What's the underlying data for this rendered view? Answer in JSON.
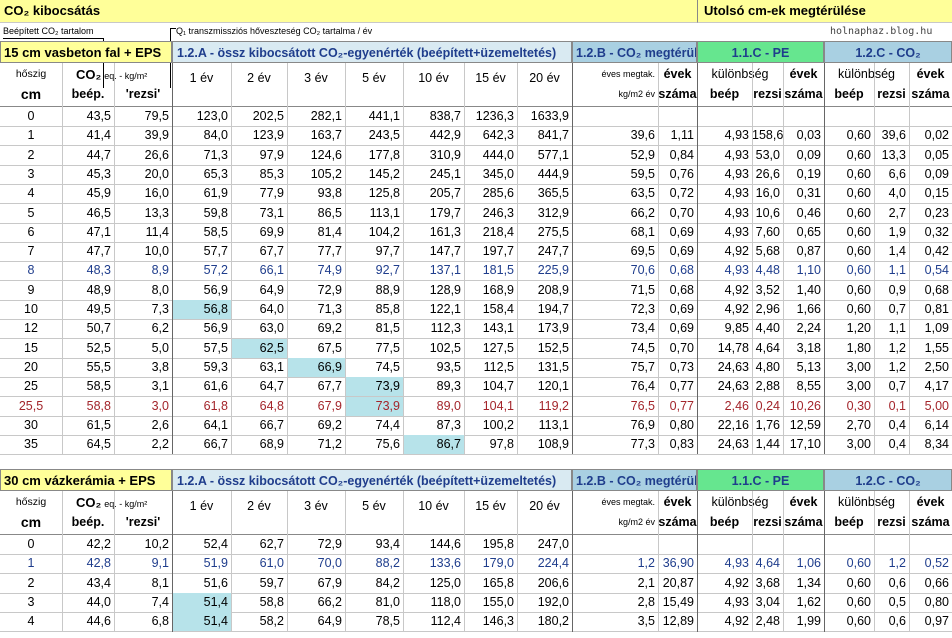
{
  "header": {
    "title": "CO₂ kibocsátás",
    "right_title": "Utolsó cm-ek megtérülése",
    "site": "holnaphaz.blog.hu",
    "ann1": "Beépített CO₂ tartalom",
    "ann2": "Q₁ transzmissziós hőveszteség CO₂ tartalma / év"
  },
  "colors": {
    "yellow": "#ffff99",
    "green": "#66e68f",
    "lightgreen": "#d6f5df",
    "blue": "#a9d0e2",
    "lightblue": "#d9eaf2",
    "highlight": "#b7e3ea",
    "rowblue": "#1f3d8c",
    "rowred": "#a3252b"
  },
  "headers": {
    "col_hoszig": "hőszig",
    "col_cm": "cm",
    "col_co2": "CO₂",
    "col_co2_unit": "eq. - kg/m²",
    "col_beep": "beép.",
    "col_rezsi": "'rezsi'",
    "years": [
      "1 év",
      "2 év",
      "3 év",
      "5 év",
      "10 év",
      "15 év",
      "20 év"
    ],
    "eves_megtak": "éves megtak.",
    "kg_m2_ev": "kg/m2 év",
    "evek": "évek",
    "szama": "száma",
    "kulonbseg": "különbség",
    "beep": "beép",
    "rezsi": "rezsi"
  },
  "section1": {
    "label": "15 cm vasbeton fal + EPS",
    "title_12a": "1.2.A - össz kibocsátott CO₂-egyenérték (beépített+üzemeltetés)",
    "title_12b": "1.2.B - CO₂ megtérül",
    "title_11c": "1.1.C - PE",
    "title_12c": "1.2.C - CO₂",
    "rows": [
      [
        "0",
        "43,5",
        "79,5",
        "123,0",
        "202,5",
        "282,1",
        "441,1",
        "838,7",
        "1236,3",
        "1633,9",
        "",
        "",
        "",
        "",
        "",
        "",
        "",
        ""
      ],
      [
        "1",
        "41,4",
        "39,9",
        "84,0",
        "123,9",
        "163,7",
        "243,5",
        "442,9",
        "642,3",
        "841,7",
        "39,6",
        "1,11",
        "4,93",
        "158,6",
        "0,03",
        "0,60",
        "39,6",
        "0,02"
      ],
      [
        "2",
        "44,7",
        "26,6",
        "71,3",
        "97,9",
        "124,6",
        "177,8",
        "310,9",
        "444,0",
        "577,1",
        "52,9",
        "0,84",
        "4,93",
        "53,0",
        "0,09",
        "0,60",
        "13,3",
        "0,05"
      ],
      [
        "3",
        "45,3",
        "20,0",
        "65,3",
        "85,3",
        "105,2",
        "145,2",
        "245,1",
        "345,0",
        "444,9",
        "59,5",
        "0,76",
        "4,93",
        "26,6",
        "0,19",
        "0,60",
        "6,6",
        "0,09"
      ],
      [
        "4",
        "45,9",
        "16,0",
        "61,9",
        "77,9",
        "93,8",
        "125,8",
        "205,7",
        "285,6",
        "365,5",
        "63,5",
        "0,72",
        "4,93",
        "16,0",
        "0,31",
        "0,60",
        "4,0",
        "0,15"
      ],
      [
        "5",
        "46,5",
        "13,3",
        "59,8",
        "73,1",
        "86,5",
        "113,1",
        "179,7",
        "246,3",
        "312,9",
        "66,2",
        "0,70",
        "4,93",
        "10,6",
        "0,46",
        "0,60",
        "2,7",
        "0,23"
      ],
      [
        "6",
        "47,1",
        "11,4",
        "58,5",
        "69,9",
        "81,4",
        "104,2",
        "161,3",
        "218,4",
        "275,5",
        "68,1",
        "0,69",
        "4,93",
        "7,60",
        "0,65",
        "0,60",
        "1,9",
        "0,32"
      ],
      [
        "7",
        "47,7",
        "10,0",
        "57,7",
        "67,7",
        "77,7",
        "97,7",
        "147,7",
        "197,7",
        "247,7",
        "69,5",
        "0,69",
        "4,92",
        "5,68",
        "0,87",
        "0,60",
        "1,4",
        "0,42"
      ],
      [
        "8",
        "48,3",
        "8,9",
        "57,2",
        "66,1",
        "74,9",
        "92,7",
        "137,1",
        "181,5",
        "225,9",
        "70,6",
        "0,68",
        "4,93",
        "4,48",
        "1,10",
        "0,60",
        "1,1",
        "0,54"
      ],
      [
        "9",
        "48,9",
        "8,0",
        "56,9",
        "64,9",
        "72,9",
        "88,9",
        "128,9",
        "168,9",
        "208,9",
        "71,5",
        "0,68",
        "4,92",
        "3,52",
        "1,40",
        "0,60",
        "0,9",
        "0,68"
      ],
      [
        "10",
        "49,5",
        "7,3",
        "56,8",
        "64,0",
        "71,3",
        "85,8",
        "122,1",
        "158,4",
        "194,7",
        "72,3",
        "0,69",
        "4,92",
        "2,96",
        "1,66",
        "0,60",
        "0,7",
        "0,81"
      ],
      [
        "12",
        "50,7",
        "6,2",
        "56,9",
        "63,0",
        "69,2",
        "81,5",
        "112,3",
        "143,1",
        "173,9",
        "73,4",
        "0,69",
        "9,85",
        "4,40",
        "2,24",
        "1,20",
        "1,1",
        "1,09"
      ],
      [
        "15",
        "52,5",
        "5,0",
        "57,5",
        "62,5",
        "67,5",
        "77,5",
        "102,5",
        "127,5",
        "152,5",
        "74,5",
        "0,70",
        "14,78",
        "4,64",
        "3,18",
        "1,80",
        "1,2",
        "1,55"
      ],
      [
        "20",
        "55,5",
        "3,8",
        "59,3",
        "63,1",
        "66,9",
        "74,5",
        "93,5",
        "112,5",
        "131,5",
        "75,7",
        "0,73",
        "24,63",
        "4,80",
        "5,13",
        "3,00",
        "1,2",
        "2,50"
      ],
      [
        "25",
        "58,5",
        "3,1",
        "61,6",
        "64,7",
        "67,7",
        "73,9",
        "89,3",
        "104,7",
        "120,1",
        "76,4",
        "0,77",
        "24,63",
        "2,88",
        "8,55",
        "3,00",
        "0,7",
        "4,17"
      ],
      [
        "25,5",
        "58,8",
        "3,0",
        "61,8",
        "64,8",
        "67,9",
        "73,9",
        "89,0",
        "104,1",
        "119,2",
        "76,5",
        "0,77",
        "2,46",
        "0,24",
        "10,26",
        "0,30",
        "0,1",
        "5,00"
      ],
      [
        "30",
        "61,5",
        "2,6",
        "64,1",
        "66,7",
        "69,2",
        "74,4",
        "87,3",
        "100,2",
        "113,1",
        "76,9",
        "0,80",
        "22,16",
        "1,76",
        "12,59",
        "2,70",
        "0,4",
        "6,14"
      ],
      [
        "35",
        "64,5",
        "2,2",
        "66,7",
        "68,9",
        "71,2",
        "75,6",
        "86,7",
        "97,8",
        "108,9",
        "77,3",
        "0,83",
        "24,63",
        "1,44",
        "17,10",
        "3,00",
        "0,4",
        "8,34"
      ]
    ]
  },
  "section2": {
    "label": "30 cm vázkerámia + EPS",
    "title_12a": "1.2.A - össz kibocsátott CO₂-egyenérték (beépített+üzemeltetés)",
    "title_12b": "1.2.B - CO₂ megtérül",
    "title_11c": "1.1.C - PE",
    "title_12c": "1.2.C - CO₂",
    "rows": [
      [
        "0",
        "42,2",
        "10,2",
        "52,4",
        "62,7",
        "72,9",
        "93,4",
        "144,6",
        "195,8",
        "247,0",
        "",
        "",
        "",
        "",
        "",
        "",
        "",
        ""
      ],
      [
        "1",
        "42,8",
        "9,1",
        "51,9",
        "61,0",
        "70,0",
        "88,2",
        "133,6",
        "179,0",
        "224,4",
        "1,2",
        "36,90",
        "4,93",
        "4,64",
        "1,06",
        "0,60",
        "1,2",
        "0,52"
      ],
      [
        "2",
        "43,4",
        "8,1",
        "51,6",
        "59,7",
        "67,9",
        "84,2",
        "125,0",
        "165,8",
        "206,6",
        "2,1",
        "20,87",
        "4,92",
        "3,68",
        "1,34",
        "0,60",
        "0,6",
        "0,66"
      ],
      [
        "3",
        "44,0",
        "7,4",
        "51,4",
        "58,8",
        "66,2",
        "81,0",
        "118,0",
        "155,0",
        "192,0",
        "2,8",
        "15,49",
        "4,93",
        "3,04",
        "1,62",
        "0,60",
        "0,5",
        "0,80"
      ],
      [
        "4",
        "44,6",
        "6,8",
        "51,4",
        "58,2",
        "64,9",
        "78,5",
        "112,4",
        "146,3",
        "180,2",
        "3,5",
        "12,89",
        "4,92",
        "2,48",
        "1,99",
        "0,60",
        "0,6",
        "0,97"
      ]
    ]
  }
}
